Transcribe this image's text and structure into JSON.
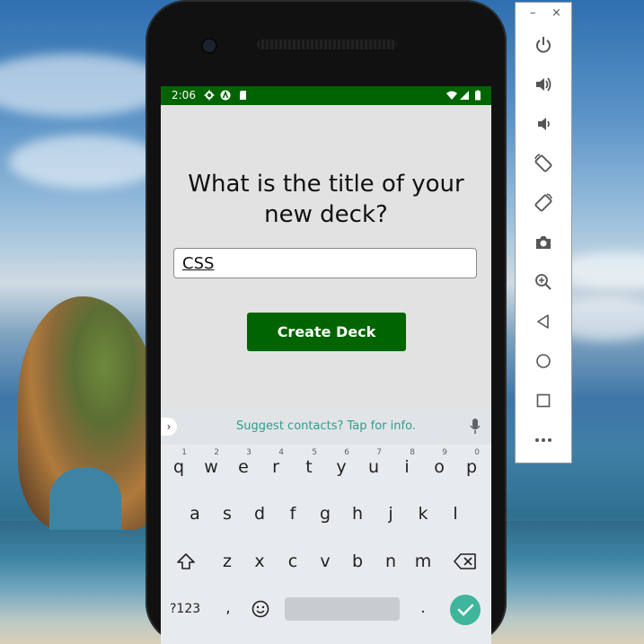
{
  "status_bar": {
    "time": "2:06"
  },
  "app": {
    "prompt": "What is the title of your new deck?",
    "title_input_value": "CSS",
    "create_button_label": "Create Deck"
  },
  "keyboard": {
    "suggestion_text": "Suggest contacts? Tap for info.",
    "row1": [
      {
        "key": "q",
        "hint": "1"
      },
      {
        "key": "w",
        "hint": "2"
      },
      {
        "key": "e",
        "hint": "3"
      },
      {
        "key": "r",
        "hint": "4"
      },
      {
        "key": "t",
        "hint": "5"
      },
      {
        "key": "y",
        "hint": "6"
      },
      {
        "key": "u",
        "hint": "7"
      },
      {
        "key": "i",
        "hint": "8"
      },
      {
        "key": "o",
        "hint": "9"
      },
      {
        "key": "p",
        "hint": "0"
      }
    ],
    "row2": [
      "a",
      "s",
      "d",
      "f",
      "g",
      "h",
      "j",
      "k",
      "l"
    ],
    "row3": [
      "z",
      "x",
      "c",
      "v",
      "b",
      "n",
      "m"
    ],
    "symbols_key": "?123",
    "comma_key": ",",
    "period_key": "."
  },
  "emulator_panel": {
    "minimize_label": "–",
    "close_label": "×",
    "buttons": [
      "power-icon",
      "volume-up-icon",
      "volume-down-icon",
      "rotate-left-icon",
      "rotate-right-icon",
      "camera-icon",
      "zoom-icon",
      "back-icon",
      "home-icon",
      "overview-icon",
      "more-icon"
    ]
  },
  "colors": {
    "accent_green": "#006400",
    "screen_bg": "#e2e2e2",
    "suggest_text": "#2f9c8f",
    "enter_key": "#3fb59b"
  }
}
